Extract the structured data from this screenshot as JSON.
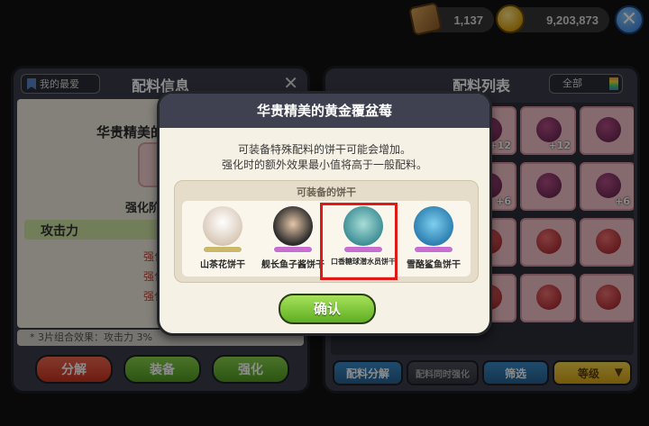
{
  "top_bar": {
    "ticket_count": "1,137",
    "coin_count": "9,203,873",
    "icons": [
      "ticket-icon",
      "coin-icon",
      "close-icon"
    ]
  },
  "left_panel": {
    "favorite_label": "我的最爱",
    "title": "配料信息",
    "item_name": "华贵精美的",
    "level_label": "强化阶",
    "stat_label": "攻击力",
    "stat_rows": [
      "强化+",
      "强化+",
      "强化+"
    ],
    "set_effect": "* 3片组合效果：攻击力 3%",
    "buttons": {
      "disassemble": "分解",
      "equip": "装备",
      "enhance": "强化"
    }
  },
  "right_panel": {
    "title": "配料列表",
    "filter_label": "全部",
    "tile_counts": [
      "+12",
      "+12",
      "+6",
      "+6"
    ],
    "buttons": {
      "disassemble": "配料分解",
      "bulk_enhance": "配料同时强化",
      "filter": "筛选",
      "sort": "等级"
    }
  },
  "modal": {
    "title": "华贵精美的黄金覆盆莓",
    "desc_line1": "可装备特殊配料的饼干可能会增加。",
    "desc_line2": "强化时的额外效果最小值将高于一般配料。",
    "box_title": "可装备的饼干",
    "cookies": [
      {
        "name": "山茶花饼干"
      },
      {
        "name": "舰长鱼子酱饼干"
      },
      {
        "name": "口香糖球潜水员饼干"
      },
      {
        "name": "雪酪鲨鱼饼干"
      }
    ],
    "confirm_label": "确认"
  }
}
